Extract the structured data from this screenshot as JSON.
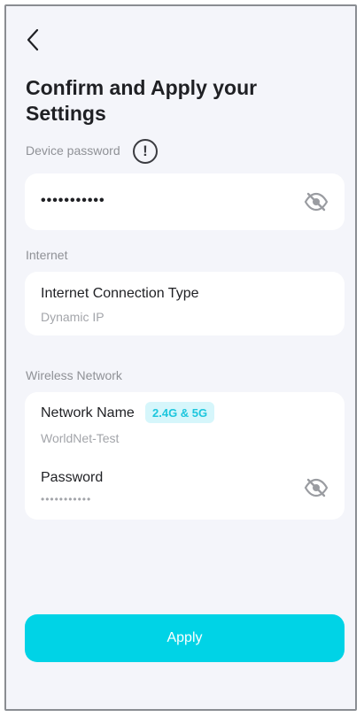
{
  "header": {
    "back_icon": "chevron-left-icon",
    "title": "Confirm and Apply your Settings"
  },
  "device_password": {
    "label": "Device password",
    "info_icon": "exclamation-circle-icon",
    "info_glyph": "!",
    "value": "•••••••••••",
    "toggle_icon": "eye-off-icon"
  },
  "internet": {
    "label": "Internet",
    "connection_type_title": "Internet Connection Type",
    "connection_type_value": "Dynamic IP"
  },
  "wireless": {
    "label": "Wireless Network",
    "network_name_title": "Network Name",
    "band_badge": "2.4G & 5G",
    "network_name_value": "WorldNet-Test",
    "password_title": "Password",
    "password_value": "•••••••••••",
    "toggle_icon": "eye-off-icon"
  },
  "actions": {
    "apply_label": "Apply"
  },
  "colors": {
    "background": "#f4f5fa",
    "accent": "#00d3e6",
    "badge_bg": "#d6f6fb",
    "badge_text": "#1cc6dd"
  }
}
